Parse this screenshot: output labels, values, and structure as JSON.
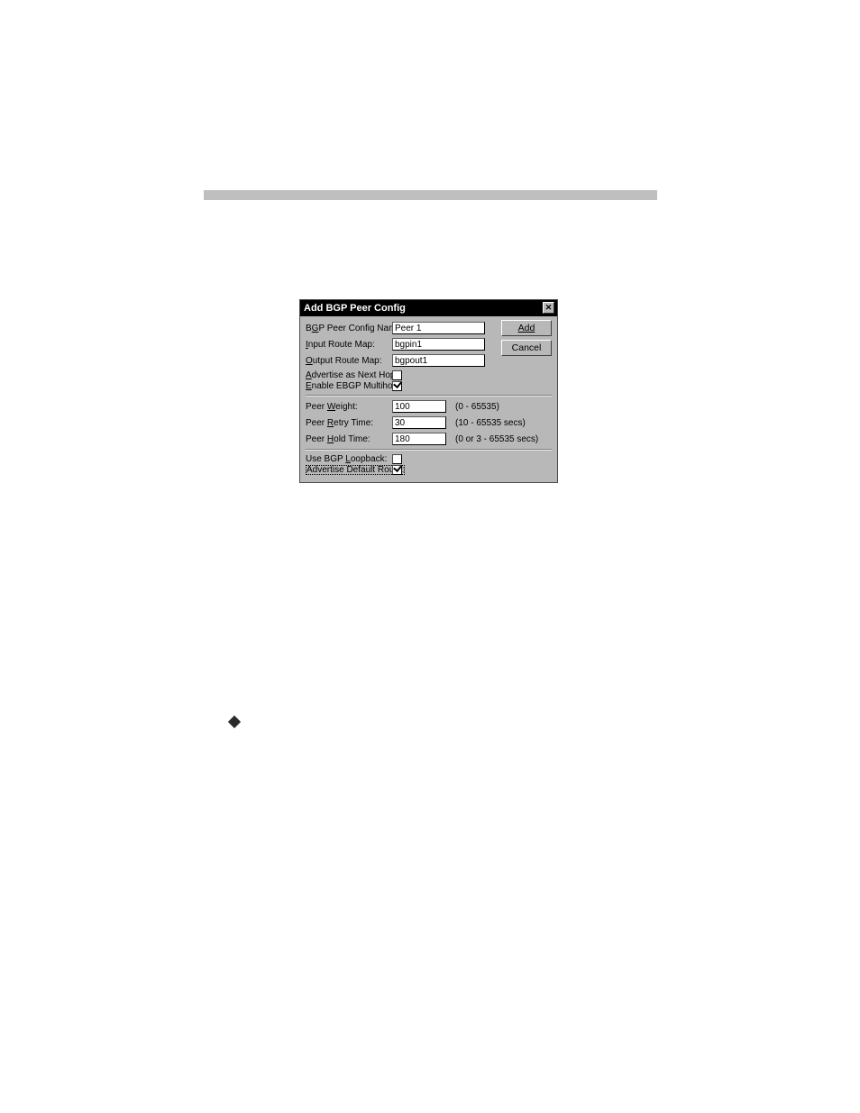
{
  "dialog": {
    "title": "Add BGP Peer Config",
    "buttons": {
      "add": "Add",
      "cancel": "Cancel"
    },
    "fields": {
      "name": {
        "label_pre": "B",
        "label_ul": "G",
        "label_post": "P Peer Config Name:",
        "value": "Peer 1"
      },
      "input_map": {
        "label_ul": "I",
        "label_post": "nput Route Map:",
        "value": "bgpin1"
      },
      "output_map": {
        "label_ul": "O",
        "label_post": "utput Route Map:",
        "value": "bgpout1"
      },
      "adv_nh": {
        "label_ul": "A",
        "label_post": "dvertise as Next Hop:",
        "checked": false
      },
      "ebgp_mh": {
        "label_ul": "E",
        "label_post": "nable EBGP Multihop:",
        "checked": true
      },
      "weight": {
        "label_pre": "Peer ",
        "label_ul": "W",
        "label_post": "eight:",
        "value": "100",
        "hint": "(0 - 65535)"
      },
      "retry": {
        "label_pre": "Peer ",
        "label_ul": "R",
        "label_post": "etry Time:",
        "value": "30",
        "hint": "(10 - 65535 secs)"
      },
      "hold": {
        "label_pre": "Peer ",
        "label_ul": "H",
        "label_post": "old Time:",
        "value": "180",
        "hint": "(0 or 3 - 65535 secs)"
      },
      "loopback": {
        "label_pre": "Use BGP ",
        "label_ul": "L",
        "label_post": "oopback:",
        "checked": false
      },
      "adv_def": {
        "label": "Advertise Default Route:",
        "checked": true
      }
    }
  }
}
